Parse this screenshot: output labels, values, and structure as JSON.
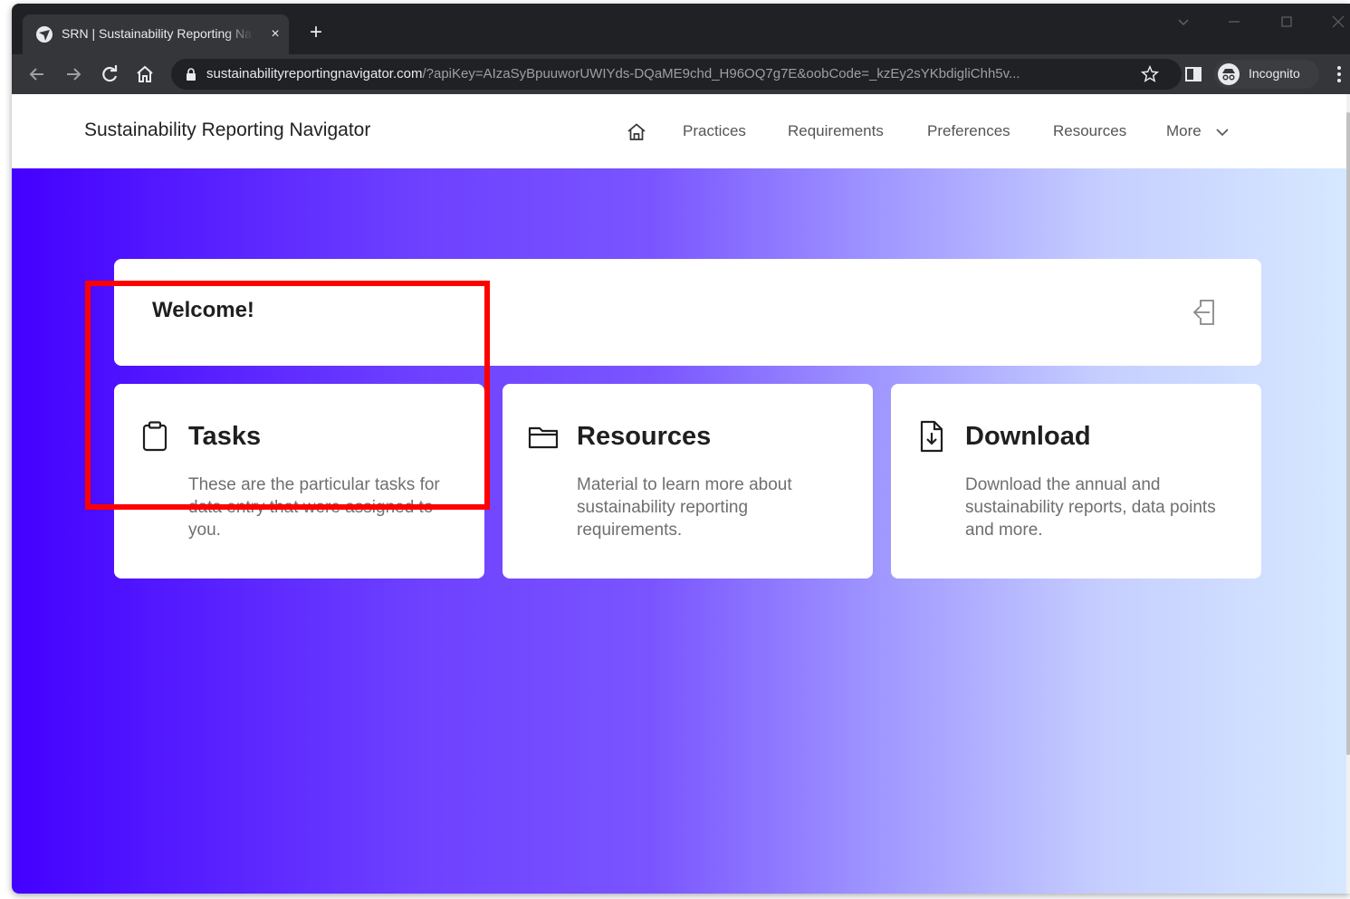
{
  "browser": {
    "tab_title": "SRN | Sustainability Reporting Navigator",
    "tab_close": "×",
    "new_tab": "+",
    "url_host": "sustainabilityreportingnavigator.com",
    "url_path": "/?apiKey=AIzaSyBpuuworUWIYds-DQaME9chd_H96OQ7g7E&oobCode=_kzEy2sYKbdigliChh5v...",
    "incognito_label": "Incognito"
  },
  "app": {
    "brand": "Sustainability Reporting Navigator",
    "nav": [
      {
        "label": "Practices"
      },
      {
        "label": "Requirements"
      },
      {
        "label": "Preferences"
      },
      {
        "label": "Resources"
      },
      {
        "label": "More"
      }
    ]
  },
  "welcome": {
    "title": "Welcome!"
  },
  "cards": [
    {
      "title": "Tasks",
      "description": "These are the particular tasks for data entry that were assigned to you.",
      "icon": "clipboard-icon"
    },
    {
      "title": "Resources",
      "description": "Material to learn more about sustainability reporting requirements.",
      "icon": "folder-icon"
    },
    {
      "title": "Download",
      "description": "Download the annual and sustainability reports, data points and more.",
      "icon": "file-download-icon"
    }
  ],
  "colors": {
    "highlight": "#ff0000",
    "hero_start": "#4300ff",
    "hero_end": "#d6e8ff",
    "browser_dark": "#202124"
  }
}
